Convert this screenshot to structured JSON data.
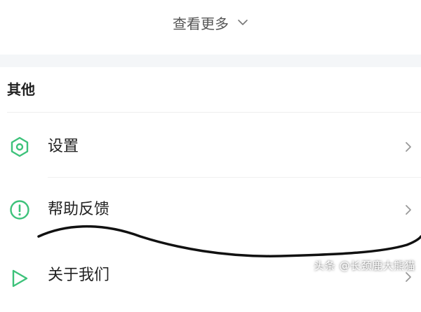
{
  "view_more": {
    "label": "查看更多",
    "icon": "chevron-down-icon"
  },
  "section": {
    "title": "其他"
  },
  "items": [
    {
      "label": "设置",
      "icon": "hexagon-settings-icon",
      "trailing": "chevron-right-icon"
    },
    {
      "label": "帮助反馈",
      "icon": "exclamation-circle-icon",
      "trailing": "chevron-right-icon"
    },
    {
      "label": "关于我们",
      "icon": "play-triangle-icon",
      "trailing": "chevron-right-icon"
    }
  ],
  "watermark": "头条 @长颈鹿大熊猫",
  "colors": {
    "accent": "#3dc27a",
    "text": "#222222",
    "muted": "#555555",
    "separator": "#f4f6f8",
    "annotation_stroke": "#111111"
  }
}
